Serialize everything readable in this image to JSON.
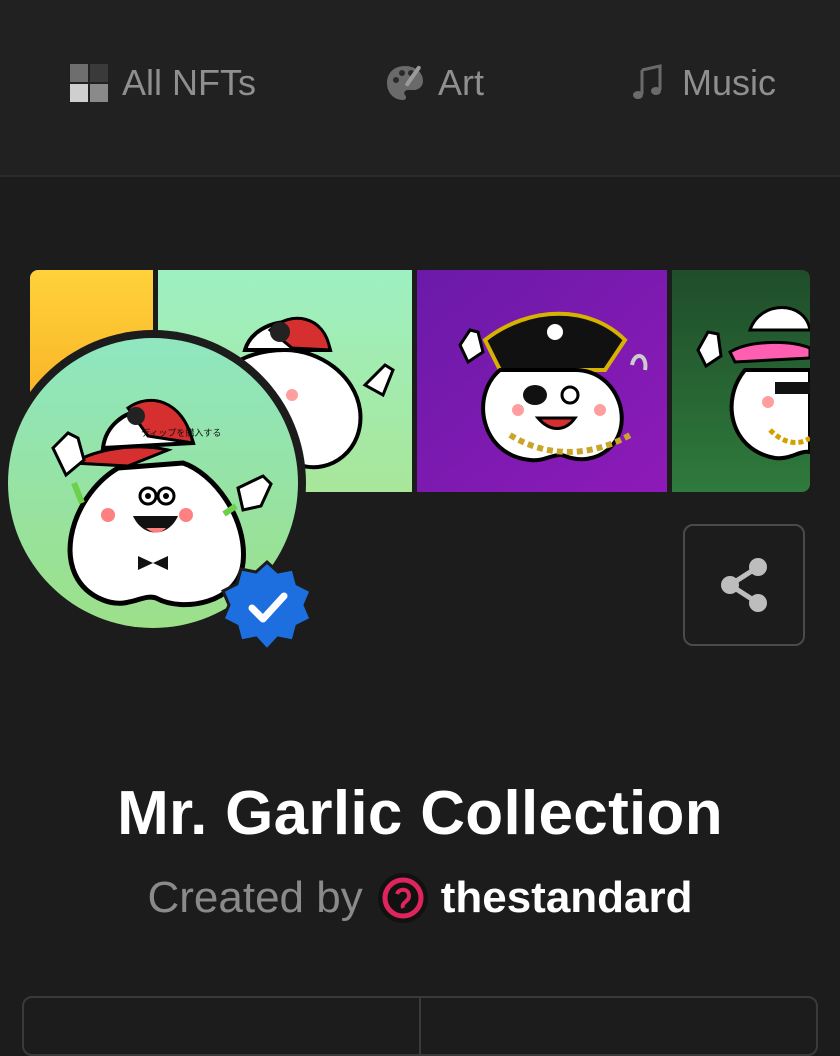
{
  "tabs": [
    {
      "label": "All NFTs",
      "icon": "grid-squares-icon"
    },
    {
      "label": "Art",
      "icon": "palette-icon"
    },
    {
      "label": "Music",
      "icon": "music-notes-icon"
    }
  ],
  "collection": {
    "title": "Mr. Garlic Collection",
    "created_by_label": "Created by",
    "creator_name": "thestandard",
    "verified": true
  },
  "banner": {
    "panels": [
      "yellow-panel",
      "mint-cap-panel",
      "purple-pirate-panel",
      "green-pink-cap-panel"
    ],
    "cap_text": "ディップを購入する"
  },
  "colors": {
    "background": "#1c1c1c",
    "verified_badge": "#1d6fe0",
    "accent_red_cap": "#d62f2f",
    "pirate_purple": "#7c17a8",
    "dark_green": "#1f5a2e",
    "mint": "#8fe6b4"
  }
}
